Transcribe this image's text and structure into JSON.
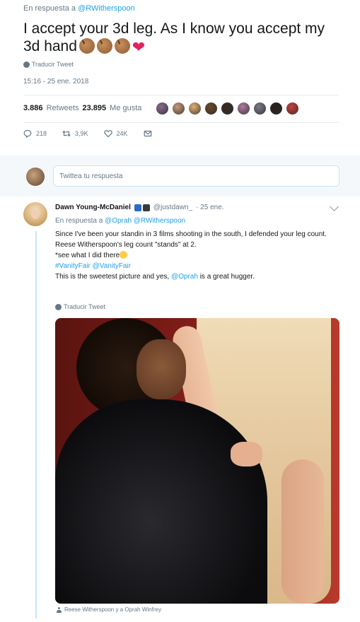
{
  "main_tweet": {
    "reply_context_prefix": "En respuesta a",
    "reply_context_handle": "@RWitherspoon",
    "text_line1": "I accept your 3d leg. As I know you accept my",
    "text_line2": "3d hand",
    "translate_label": "Traducir Tweet",
    "timestamp": "15:16 - 25 ene. 2018",
    "retweets_count": "3.886",
    "retweets_label": "Retweets",
    "likes_count": "23.895",
    "likes_label": "Me gusta",
    "actions": {
      "reply_count": "218",
      "retweet_count": "3,9K",
      "like_count": "24K"
    },
    "liker_avatar_colors": [
      "#8a6a8e",
      "#c89a7a",
      "#e0b070",
      "#6a4a2a",
      "#3a2a20",
      "#b07aa0",
      "#7a7a8a",
      "#2a2020",
      "#c8403a"
    ]
  },
  "reply_box": {
    "placeholder": "Twittea tu respuesta"
  },
  "reply_tweet": {
    "name": "Dawn Young-McDaniel",
    "handle": "@justdawn_",
    "date": "· 25 ene.",
    "reply_context_prefix": "En respuesta a",
    "reply_context_handles": "@Oprah @RWitherspoon",
    "body_line1": "Since I've been your standin in 3 films shooting in the south, I defended your leg count.",
    "body_line2": "Reese Witherspoon's leg count \"stands\" at 2.",
    "body_line3": "*see what I did there",
    "body_line4": "#VanityFair @VanityFair",
    "body_line5_prefix": "This is the sweetest picture and yes,",
    "body_line5_mention": "@Oprah",
    "body_line5_suffix": "is a great hugger.",
    "translate_label": "Traducir Tweet",
    "photo_caption": "Reese Witherspoon y a Oprah Winfrey"
  },
  "colors": {
    "link": "#1da1f2",
    "secondary_text": "#657786",
    "heart": "#e0245e",
    "thread_line": "#c5e5f9"
  }
}
